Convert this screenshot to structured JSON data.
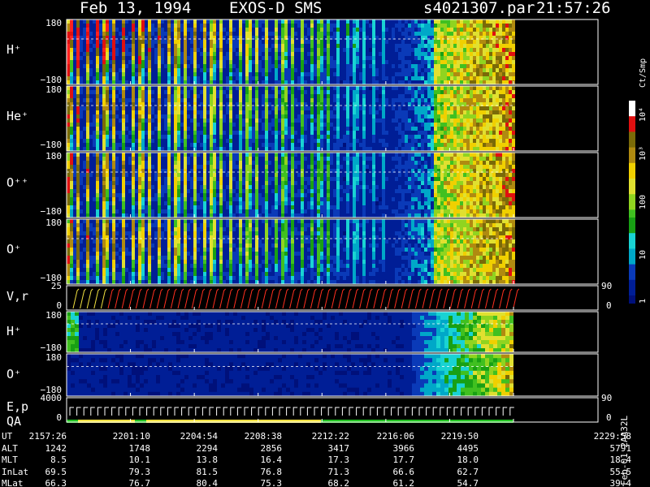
{
  "header": {
    "date": "Feb 13, 1994",
    "instrument": "EXOS-D SMS",
    "file": "s4021307.par",
    "time": "21:57:26"
  },
  "colorbar": {
    "unit": "Ct/Smp",
    "ticks": [
      "10⁴",
      "10³",
      "100",
      "10",
      "1"
    ]
  },
  "panels": [
    {
      "label": "H⁺",
      "top": "180",
      "bottom": "−180"
    },
    {
      "label": "He⁺",
      "top": "180",
      "bottom": "−180"
    },
    {
      "label": "O⁺⁺",
      "top": "180",
      "bottom": "−180"
    },
    {
      "label": "O⁺",
      "top": "180",
      "bottom": "−180"
    },
    {
      "label": "V,r",
      "top": "25",
      "bottom": "0",
      "right_top": "90",
      "right_bottom": "0"
    },
    {
      "label": "H⁺",
      "top": "180",
      "bottom": "−180"
    },
    {
      "label": "O⁺",
      "top": "180",
      "bottom": "−180"
    },
    {
      "label": "E,p",
      "label2": "QA",
      "top": "4000",
      "bottom": "0",
      "right_top": "90",
      "right_bottom": "0"
    }
  ],
  "footer": {
    "rows": [
      {
        "name": "UT",
        "values": [
          "2157:26",
          "2201:10",
          "2204:54",
          "2208:38",
          "2212:22",
          "2216:06",
          "2219:50",
          "2229:58"
        ]
      },
      {
        "name": "ALT",
        "values": [
          "1242",
          "1748",
          "2294",
          "2856",
          "3417",
          "3966",
          "4495",
          "5791"
        ]
      },
      {
        "name": "MLT",
        "values": [
          "8.5",
          "10.1",
          "13.8",
          "16.4",
          "17.3",
          "17.7",
          "18.0",
          "18.4"
        ]
      },
      {
        "name": "InLat",
        "values": [
          "69.5",
          "79.3",
          "81.5",
          "76.8",
          "71.3",
          "66.6",
          "62.7",
          "55.5"
        ]
      },
      {
        "name": "MLat",
        "values": [
          "66.3",
          "76.7",
          "80.4",
          "75.3",
          "68.2",
          "61.2",
          "54.7",
          "39.4"
        ]
      }
    ],
    "side_label": "Feb-01 2AA32L"
  },
  "chart_data": {
    "type": "heatmap",
    "title": "Feb 13, 1994   EXOS-D SMS",
    "colorbar_label": "Ct/Smp",
    "colorbar_ticks": [
      "1",
      "10",
      "100",
      "10³",
      "10⁴"
    ],
    "x_tick_labels": [
      "2157:26",
      "2201:10",
      "2204:54",
      "2208:38",
      "2212:22",
      "2216:06",
      "2219:50",
      "2229:58"
    ],
    "panels": [
      {
        "label": "H⁺",
        "ylim": [
          -180,
          180
        ]
      },
      {
        "label": "He⁺",
        "ylim": [
          -180,
          180
        ]
      },
      {
        "label": "O⁺⁺",
        "ylim": [
          -180,
          180
        ]
      },
      {
        "label": "O⁺",
        "ylim": [
          -180,
          180
        ]
      },
      {
        "label": "V,r",
        "ylim": [
          0,
          25
        ]
      },
      {
        "label": "H⁺",
        "ylim": [
          -180,
          180
        ]
      },
      {
        "label": "O⁺",
        "ylim": [
          -180,
          180
        ]
      },
      {
        "label": "E,p / QA",
        "ylim": [
          0,
          4000
        ]
      }
    ]
  }
}
